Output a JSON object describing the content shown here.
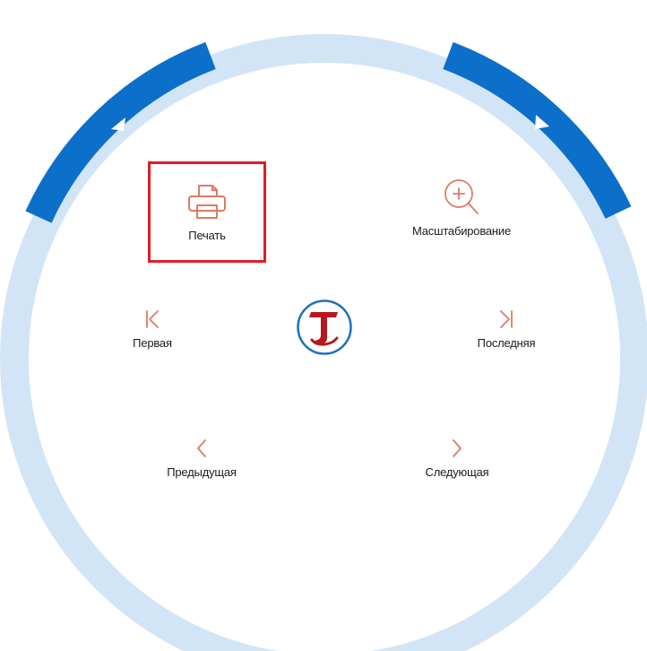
{
  "menu": {
    "print_label": "Печать",
    "zoom_label": "Масштабирование",
    "first_label": "Первая",
    "last_label": "Последняя",
    "prev_label": "Предыдущая",
    "next_label": "Следующая"
  },
  "colors": {
    "ring_light": "#d2e5f6",
    "ring_accent": "#0c6fca",
    "icon_accent": "#e07a63",
    "highlight_border": "#e21b24",
    "logo_red": "#b5191f",
    "logo_blue": "#1e6fc4"
  },
  "icons": {
    "print": "printer-icon",
    "zoom": "zoom-in-icon",
    "first": "first-page-icon",
    "last": "last-page-icon",
    "prev": "chevron-left-icon",
    "next": "chevron-right-icon",
    "logo": "app-logo"
  }
}
